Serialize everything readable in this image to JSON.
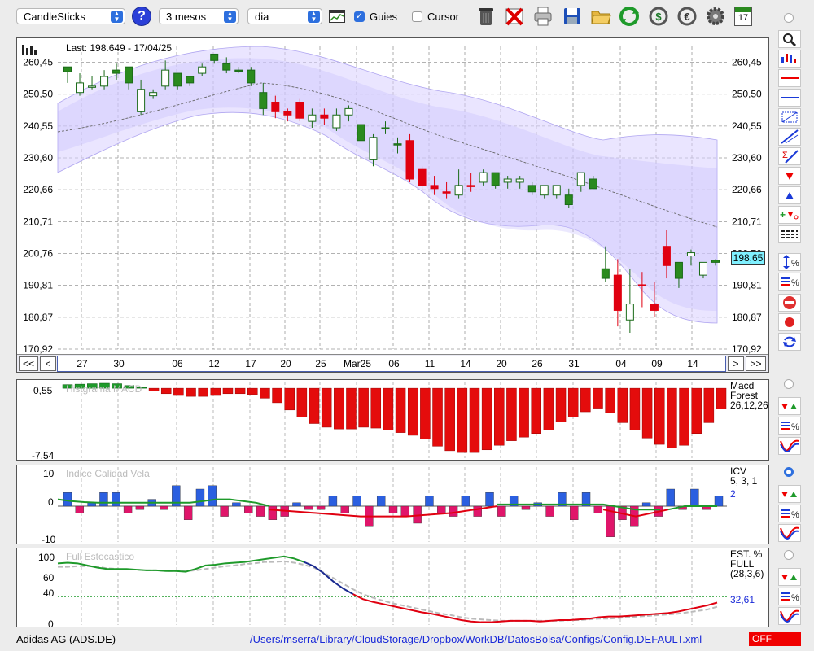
{
  "toolbar": {
    "chart_type": "CandleSticks",
    "period": "3 mesos",
    "interval": "dia",
    "guides_label": "Guies",
    "guides_checked": true,
    "cursor_label": "Cursor",
    "cursor_checked": false,
    "calendar_day": "17"
  },
  "main_chart": {
    "last_label": "Last: 198.649 - 17/04/25",
    "y_ticks": [
      "260,45",
      "250,50",
      "240,55",
      "230,60",
      "220,66",
      "210,71",
      "200,76",
      "190,81",
      "180,87",
      "170,92"
    ],
    "y_range": [
      170.92,
      265.4
    ],
    "last_value_badge": "198,65",
    "x_labels": [
      "27",
      "30",
      "06",
      "12",
      "17",
      "20",
      "25",
      "Mar25",
      "06",
      "11",
      "14",
      "20",
      "26",
      "31",
      "04",
      "09",
      "14"
    ],
    "nav": {
      "first": "<<",
      "prev": "<",
      "next": ">",
      "last": ">>"
    }
  },
  "chart_data": [
    {
      "type": "candlestick",
      "title": "",
      "y_ticks": [
        260.45,
        250.5,
        240.55,
        230.6,
        220.66,
        210.71,
        200.76,
        190.81,
        180.87,
        170.92
      ],
      "candles": [
        {
          "o": 257.5,
          "h": 259,
          "c": 259,
          "l": 254,
          "up": true
        },
        {
          "o": 251,
          "h": 257,
          "c": 254,
          "l": 250,
          "up": false
        },
        {
          "o": 253,
          "h": 256,
          "c": 253,
          "l": 252,
          "up": false
        },
        {
          "o": 253,
          "h": 258,
          "c": 256,
          "l": 252,
          "up": false
        },
        {
          "o": 257,
          "h": 260,
          "c": 258,
          "l": 255,
          "up": true
        },
        {
          "o": 254,
          "h": 258,
          "c": 259,
          "l": 252,
          "up": true
        },
        {
          "o": 245,
          "h": 255,
          "c": 252,
          "l": 244,
          "up": false
        },
        {
          "o": 251,
          "h": 252,
          "c": 250,
          "l": 249,
          "up": false
        },
        {
          "o": 253,
          "h": 261,
          "c": 258,
          "l": 252,
          "up": false
        },
        {
          "o": 253,
          "h": 257,
          "c": 257,
          "l": 252,
          "up": true
        },
        {
          "o": 254,
          "h": 256,
          "c": 256,
          "l": 253,
          "up": true
        },
        {
          "o": 257,
          "h": 260,
          "c": 259,
          "l": 256,
          "up": false
        },
        {
          "o": 261,
          "h": 263,
          "c": 263,
          "l": 260,
          "up": true
        },
        {
          "o": 258,
          "h": 262,
          "c": 260,
          "l": 257,
          "up": true
        },
        {
          "o": 258,
          "h": 259,
          "c": 258,
          "l": 257,
          "up": true
        },
        {
          "o": 254,
          "h": 259,
          "c": 258,
          "l": 253,
          "up": true
        },
        {
          "o": 246,
          "h": 254,
          "c": 251,
          "l": 244,
          "up": true
        },
        {
          "o": 248,
          "h": 250,
          "c": 245,
          "l": 243,
          "down": true
        },
        {
          "o": 245,
          "h": 246,
          "c": 244,
          "l": 242,
          "down": true
        },
        {
          "o": 248,
          "h": 249,
          "c": 243,
          "l": 242,
          "down": true
        },
        {
          "o": 242,
          "h": 246,
          "c": 244,
          "l": 240,
          "up": false
        },
        {
          "o": 244,
          "h": 246,
          "c": 243,
          "l": 241,
          "down": true
        },
        {
          "o": 240,
          "h": 246,
          "c": 244,
          "l": 239,
          "up": false
        },
        {
          "o": 244,
          "h": 247,
          "c": 246,
          "l": 242,
          "up": false
        },
        {
          "o": 241,
          "h": 239,
          "c": 236,
          "l": 236,
          "up": true
        },
        {
          "o": 237,
          "h": 238,
          "c": 230,
          "l": 228,
          "up": false
        },
        {
          "o": 240,
          "h": 242,
          "c": 240,
          "l": 238,
          "up": true
        },
        {
          "o": 235,
          "h": 237,
          "c": 235,
          "l": 232,
          "up": true
        },
        {
          "o": 236,
          "h": 238,
          "c": 224,
          "l": 223,
          "down": true
        },
        {
          "o": 227,
          "h": 228,
          "c": 222,
          "l": 220,
          "down": true
        },
        {
          "o": 222,
          "h": 225,
          "c": 221,
          "l": 219,
          "down": true
        },
        {
          "o": 220,
          "h": 223,
          "c": 220,
          "l": 218,
          "down": true
        },
        {
          "o": 219,
          "h": 227,
          "c": 222,
          "l": 218,
          "up": false
        },
        {
          "o": 222,
          "h": 226,
          "c": 222,
          "l": 220,
          "down": true
        },
        {
          "o": 226,
          "h": 227,
          "c": 223,
          "l": 222,
          "up": false
        },
        {
          "o": 222,
          "h": 226,
          "c": 226,
          "l": 221,
          "up": true
        },
        {
          "o": 223,
          "h": 225,
          "c": 224,
          "l": 221,
          "up": false
        },
        {
          "o": 224,
          "h": 225,
          "c": 223,
          "l": 221,
          "up": false
        },
        {
          "o": 220,
          "h": 223,
          "c": 222,
          "l": 219,
          "up": true
        },
        {
          "o": 219,
          "h": 222,
          "c": 222,
          "l": 218,
          "up": false
        },
        {
          "o": 219,
          "h": 222,
          "c": 222,
          "l": 218,
          "up": false
        },
        {
          "o": 219,
          "h": 221,
          "c": 216,
          "l": 215,
          "up": true
        },
        {
          "o": 222,
          "h": 225,
          "c": 226,
          "l": 220,
          "up": false
        },
        {
          "o": 224,
          "h": 225,
          "c": 221,
          "l": 221,
          "up": true
        },
        {
          "o": 196,
          "h": 203,
          "c": 193,
          "l": 192,
          "up": true
        },
        {
          "o": 194,
          "h": 199,
          "c": 183,
          "l": 178,
          "down": true
        },
        {
          "o": 180,
          "h": 196,
          "c": 185,
          "l": 176,
          "up": false
        },
        {
          "o": 191,
          "h": 195,
          "c": 191,
          "l": 184,
          "down": true
        },
        {
          "o": 185,
          "h": 192,
          "c": 183,
          "l": 181,
          "down": true
        },
        {
          "o": 197,
          "h": 208,
          "c": 203,
          "l": 193,
          "down": true
        },
        {
          "o": 193,
          "h": 198,
          "c": 198,
          "l": 190,
          "up": true
        },
        {
          "o": 201,
          "h": 202,
          "c": 200,
          "l": 197,
          "up": false
        },
        {
          "o": 194,
          "h": 198,
          "c": 198,
          "l": 193,
          "up": false
        },
        {
          "o": 198,
          "h": 199,
          "c": 198.65,
          "l": 197,
          "up": true
        }
      ]
    },
    {
      "type": "bar",
      "title": "",
      "panel_label": "Histgrama MACD",
      "right_label_1": "Macd",
      "right_label_2": "Forest",
      "right_label_3": "26,12,26",
      "y_ticks_text": [
        "0,55",
        "-7,54"
      ],
      "ylim": [
        -7.54,
        0.55
      ],
      "values": [
        0.4,
        0.45,
        0.5,
        0.55,
        0.5,
        0.3,
        0.1,
        -0.3,
        -0.6,
        -0.8,
        -0.9,
        -0.9,
        -0.8,
        -0.6,
        -0.6,
        -0.7,
        -1.1,
        -1.6,
        -2.4,
        -3.2,
        -3.9,
        -4.3,
        -4.5,
        -4.5,
        -4.3,
        -4.4,
        -4.6,
        -4.9,
        -5.2,
        -5.6,
        -6.4,
        -6.9,
        -7.1,
        -7.1,
        -6.8,
        -6.3,
        -5.8,
        -5.4,
        -5.0,
        -4.6,
        -3.7,
        -3.2,
        -2.6,
        -2.2,
        -2.7,
        -3.8,
        -4.6,
        -5.5,
        -6.2,
        -6.6,
        -6.3,
        -5.0,
        -3.8,
        -2.3
      ]
    },
    {
      "type": "bar",
      "title": "",
      "panel_label": "Indice Calidad Vela",
      "right_label_1": "ICV",
      "right_label_2": "5, 3, 1",
      "right_value": "2",
      "y_ticks_text": [
        "10",
        "0",
        "-10"
      ],
      "ylim": [
        -10,
        10
      ],
      "values": [
        4,
        -2,
        1,
        4,
        4,
        -2,
        -1,
        2,
        -1,
        6,
        -4,
        5,
        6,
        -3,
        1,
        -2,
        -3,
        -4,
        -3,
        1,
        -1,
        -1,
        3,
        -2,
        3,
        -6,
        3,
        -2,
        -3,
        -5,
        3,
        -2,
        -3,
        3,
        -3,
        4,
        -3,
        3,
        -1,
        1,
        -3,
        4,
        -4,
        4,
        -2,
        -9,
        -4,
        -6,
        1,
        -3,
        5,
        -1,
        5,
        -1,
        3
      ],
      "series": [
        {
          "name": "green",
          "values": [
            2,
            1.5,
            1.2,
            1,
            1,
            1,
            1,
            1,
            1,
            1,
            1,
            1.5,
            2,
            2,
            1.5,
            1,
            0
          ]
        },
        {
          "name": "red",
          "values": [
            -1,
            -2,
            -3,
            -3,
            -2,
            0
          ]
        }
      ]
    },
    {
      "type": "line",
      "title": "",
      "panel_label": "Full Estocastico",
      "right_label_1": "EST. %",
      "right_label_2": "FULL",
      "right_label_3": "(28,3,6)",
      "right_value": "32,61",
      "y_ticks_text": [
        "100",
        "60",
        "40",
        "0"
      ],
      "ylim": [
        0,
        100
      ],
      "series": [
        {
          "name": "K",
          "values": [
            88,
            89,
            88,
            85,
            82,
            80,
            80,
            80,
            79,
            78,
            78,
            77,
            77,
            76,
            80,
            85,
            86,
            88,
            89,
            90,
            92,
            94,
            96,
            98,
            95,
            90,
            84,
            74,
            62,
            52,
            44,
            37,
            33,
            30,
            27,
            24,
            21,
            18,
            16,
            13,
            10,
            7,
            5,
            4,
            4,
            5,
            6,
            6,
            6,
            5,
            6,
            7,
            7,
            8,
            9,
            11,
            12,
            12,
            13,
            14,
            15,
            16,
            17,
            19,
            22,
            25,
            28,
            32
          ]
        },
        {
          "name": "D",
          "values": [
            83,
            83,
            84,
            84,
            83,
            81,
            80,
            79,
            79,
            78,
            78,
            77,
            77,
            77,
            78,
            80,
            82,
            84,
            85,
            87,
            88,
            90,
            90,
            91,
            89,
            86,
            82,
            75,
            67,
            59,
            51,
            44,
            39,
            35,
            31,
            28,
            25,
            22,
            19,
            16,
            14,
            11,
            9,
            8,
            7,
            6,
            6,
            6,
            6,
            6,
            6,
            6,
            7,
            7,
            8,
            9,
            9,
            10,
            11,
            12,
            13,
            14,
            15,
            16,
            18,
            20,
            22,
            26
          ]
        }
      ]
    }
  ],
  "status": {
    "ticker": "Adidas AG (ADS.DE)",
    "config_path": "/Users/mserra/Library/CloudStorage/Dropbox/WorkDB/DatosBolsa/Configs/Config.DEFAULT.xml",
    "state": "OFF"
  },
  "colors": {
    "up": "#2a8a1e",
    "down": "#e00010",
    "accent": "#2d6fde",
    "band": "#d8d0ff",
    "macd": "#e40c0c",
    "icv_pos": "#2b5fe0",
    "icv_neg": "#e0156a",
    "off_bg": "#f00000"
  }
}
